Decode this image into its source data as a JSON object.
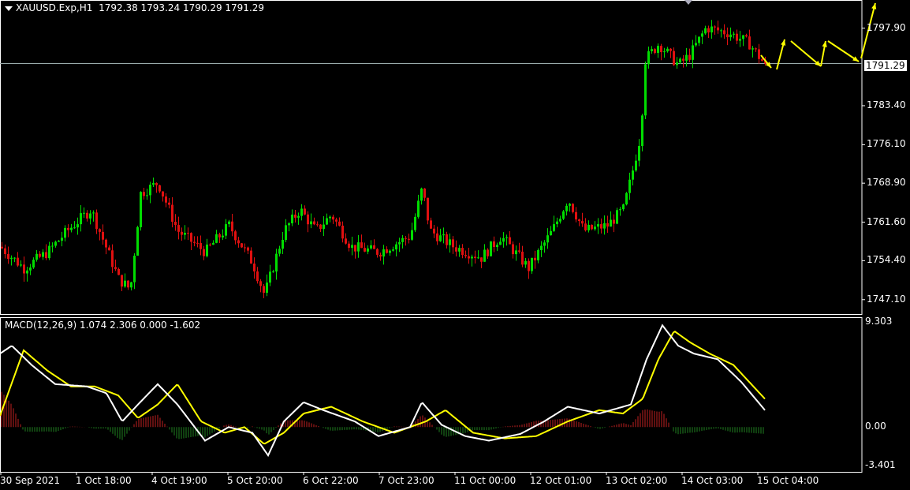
{
  "header": {
    "symbol": "XAUUSD.Exp,H1",
    "ohlc": "1792.38 1793.24 1790.29 1791.29"
  },
  "price_axis": {
    "ticks": [
      "1797.90",
      "1783.40",
      "1776.10",
      "1768.90",
      "1761.60",
      "1754.40",
      "1747.10"
    ],
    "current": "1791.29"
  },
  "macd": {
    "label": "MACD(12,26,9) 1.074 2.306 0.000 -1.602",
    "ticks": [
      "9.303",
      "0.00",
      "-3.401"
    ]
  },
  "time_axis": {
    "ticks": [
      "30 Sep 2021",
      "1 Oct 18:00",
      "4 Oct 19:00",
      "5 Oct 20:00",
      "6 Oct 22:00",
      "7 Oct 23:00",
      "11 Oct 00:00",
      "12 Oct 01:00",
      "13 Oct 02:00",
      "14 Oct 03:00",
      "15 Oct 04:00"
    ]
  },
  "colors": {
    "bull": "#00dd00",
    "bear": "#e01010",
    "macd_line": "#ffffff",
    "signal_line": "#ffff00",
    "grid": "#ffffff",
    "arrow": "#ffff00"
  },
  "chart_data": [
    {
      "type": "candlestick",
      "title": "XAUUSD.Exp,H1",
      "ylim": [
        1745,
        1802
      ],
      "close_path_keypoints": [
        {
          "t": "30 Sep 2021",
          "price": 1757
        },
        {
          "t": "1 Oct 18:00",
          "price": 1761
        },
        {
          "t": "4 Oct 19:00",
          "price": 1768
        },
        {
          "t": "5 Oct 20:00",
          "price": 1748
        },
        {
          "t": "6 Oct 22:00",
          "price": 1762
        },
        {
          "t": "7 Oct 23:00",
          "price": 1760
        },
        {
          "t": "11 Oct 00:00",
          "price": 1755
        },
        {
          "t": "12 Oct 01:00",
          "price": 1761
        },
        {
          "t": "13 Oct 02:00",
          "price": 1794
        },
        {
          "t": "14 Oct 03:00",
          "price": 1798
        },
        {
          "t": "15 Oct 04:00",
          "price": 1791.29
        }
      ],
      "last_ohlc": {
        "open": 1792.38,
        "high": 1793.24,
        "low": 1790.29,
        "close": 1791.29
      }
    },
    {
      "type": "line",
      "title": "MACD(12,26,9)",
      "ylim": [
        -3.401,
        9.303
      ],
      "values": {
        "macd": 1.074,
        "signal": 2.306
      }
    }
  ]
}
